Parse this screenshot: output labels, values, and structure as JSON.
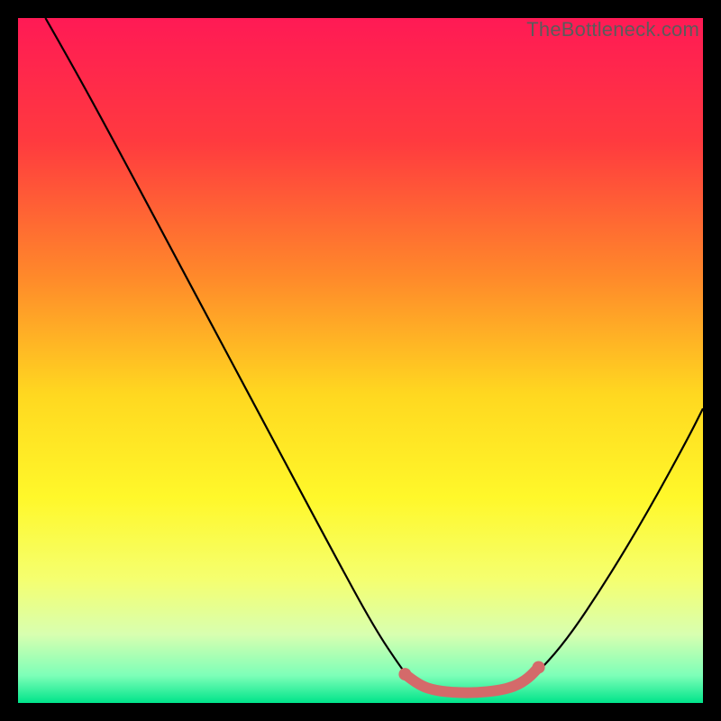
{
  "watermark": "TheBottleneck.com",
  "chart_data": {
    "type": "line",
    "title": "",
    "xlabel": "",
    "ylabel": "",
    "xlim": [
      0,
      100
    ],
    "ylim": [
      0,
      100
    ],
    "background_gradient": {
      "stops": [
        {
          "offset": 0.0,
          "color": "#ff1a55"
        },
        {
          "offset": 0.18,
          "color": "#ff3a3f"
        },
        {
          "offset": 0.38,
          "color": "#ff8a2a"
        },
        {
          "offset": 0.55,
          "color": "#ffd820"
        },
        {
          "offset": 0.7,
          "color": "#fff82a"
        },
        {
          "offset": 0.82,
          "color": "#f5ff70"
        },
        {
          "offset": 0.9,
          "color": "#d8ffb0"
        },
        {
          "offset": 0.96,
          "color": "#7dffb8"
        },
        {
          "offset": 1.0,
          "color": "#00e48a"
        }
      ]
    },
    "series": [
      {
        "name": "bottleneck-curve",
        "color": "#000000",
        "width": 2.2,
        "points": [
          {
            "x": 4,
            "y": 100
          },
          {
            "x": 8,
            "y": 93
          },
          {
            "x": 14,
            "y": 82
          },
          {
            "x": 22,
            "y": 67
          },
          {
            "x": 30,
            "y": 52
          },
          {
            "x": 38,
            "y": 37
          },
          {
            "x": 46,
            "y": 22
          },
          {
            "x": 52,
            "y": 11
          },
          {
            "x": 56,
            "y": 5
          },
          {
            "x": 58,
            "y": 2.5
          },
          {
            "x": 60,
            "y": 1.5
          },
          {
            "x": 64,
            "y": 1.2
          },
          {
            "x": 68,
            "y": 1.2
          },
          {
            "x": 72,
            "y": 1.8
          },
          {
            "x": 75,
            "y": 3.5
          },
          {
            "x": 80,
            "y": 9
          },
          {
            "x": 86,
            "y": 18
          },
          {
            "x": 92,
            "y": 28
          },
          {
            "x": 98,
            "y": 39
          },
          {
            "x": 100,
            "y": 43
          }
        ]
      },
      {
        "name": "highlight-band",
        "color": "#d46a6a",
        "width": 12,
        "points": [
          {
            "x": 56.5,
            "y": 4.2
          },
          {
            "x": 58.5,
            "y": 2.6
          },
          {
            "x": 61,
            "y": 1.8
          },
          {
            "x": 64,
            "y": 1.5
          },
          {
            "x": 67,
            "y": 1.5
          },
          {
            "x": 70,
            "y": 1.8
          },
          {
            "x": 72.5,
            "y": 2.4
          },
          {
            "x": 74.5,
            "y": 3.6
          },
          {
            "x": 76,
            "y": 5.2
          }
        ]
      }
    ],
    "highlight_dots": {
      "color": "#d46a6a",
      "radius": 7,
      "points": [
        {
          "x": 56.5,
          "y": 4.2
        },
        {
          "x": 76,
          "y": 5.2
        }
      ]
    }
  }
}
